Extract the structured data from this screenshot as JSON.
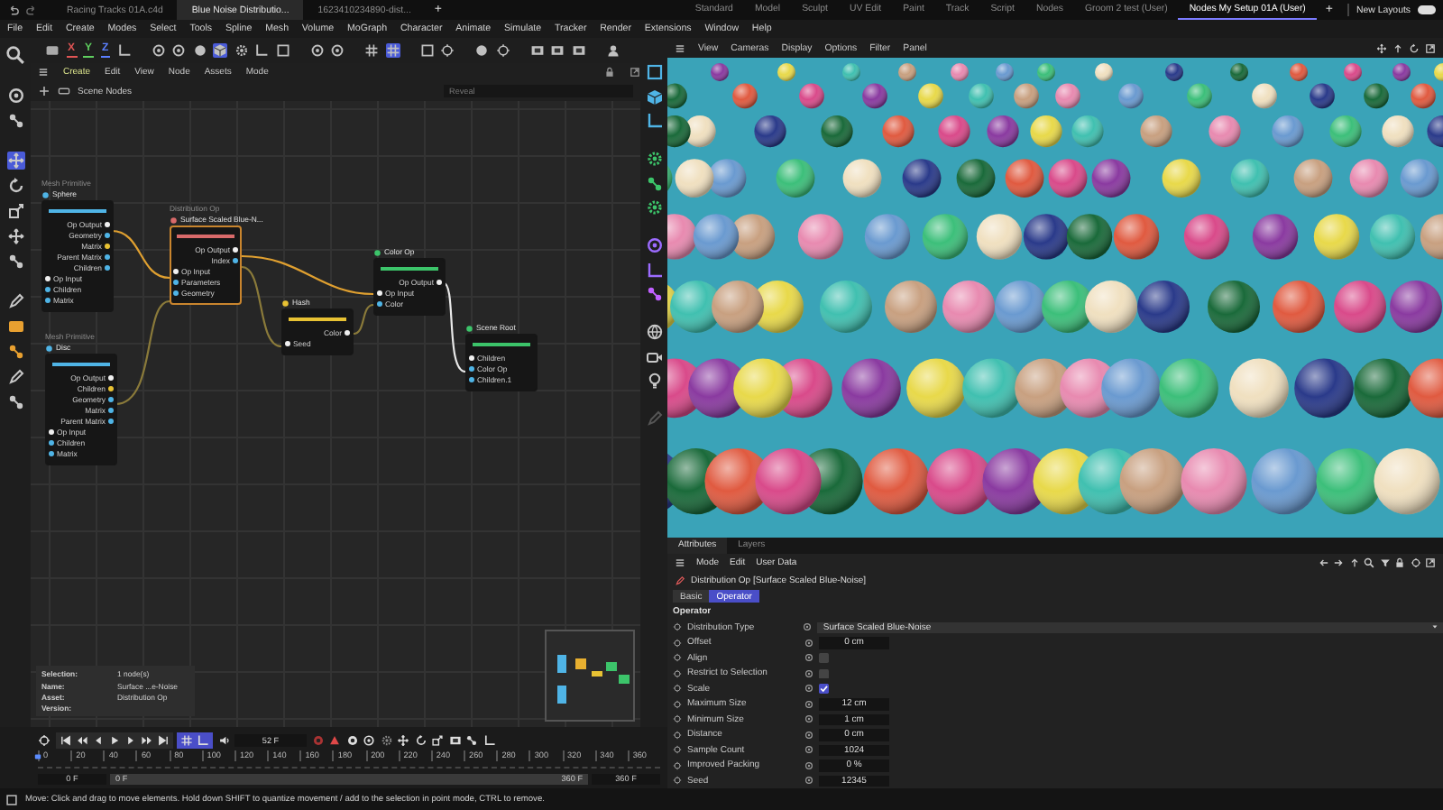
{
  "document_tabs": [
    {
      "label": "Racing Tracks 01A.c4d",
      "selected": false
    },
    {
      "label": "Blue Noise Distributio...",
      "selected": true
    },
    {
      "label": "1623410234890-dist...",
      "selected": false
    }
  ],
  "new_tab_button": "+",
  "layouts": [
    {
      "label": "Standard",
      "selected": false
    },
    {
      "label": "Model",
      "selected": false
    },
    {
      "label": "Sculpt",
      "selected": false
    },
    {
      "label": "UV Edit",
      "selected": false
    },
    {
      "label": "Paint",
      "selected": false
    },
    {
      "label": "Track",
      "selected": false
    },
    {
      "label": "Script",
      "selected": false
    },
    {
      "label": "Nodes",
      "selected": false
    },
    {
      "label": "Groom 2 test (User)",
      "selected": false
    },
    {
      "label": "Nodes My Setup 01A (User)",
      "selected": true
    }
  ],
  "add_layout_button": "+",
  "new_layouts": {
    "label": "New Layouts",
    "on": true
  },
  "menu": [
    "File",
    "Edit",
    "Create",
    "Modes",
    "Select",
    "Tools",
    "Spline",
    "Mesh",
    "Volume",
    "MoGraph",
    "Character",
    "Animate",
    "Simulate",
    "Tracker",
    "Render",
    "Extensions",
    "Window",
    "Help"
  ],
  "toolbar": {
    "axis_buttons": [
      {
        "label": "X",
        "color": "#e05555"
      },
      {
        "label": "Y",
        "color": "#5fcf5f"
      },
      {
        "label": "Z",
        "color": "#5b7fff"
      }
    ]
  },
  "node_editor": {
    "menu": [
      "Create",
      "Edit",
      "View",
      "Node",
      "Assets",
      "Mode"
    ],
    "path": "Scene Nodes",
    "search": {
      "placeholder": "Reveal"
    },
    "nodes": [
      {
        "caption": "Mesh Primitive",
        "title": "Sphere",
        "color": "#4fb4e6",
        "selected": false,
        "outputs": [
          "Op Output",
          "Geometry",
          "Matrix",
          "Parent Matrix",
          "Children"
        ],
        "inputs": [
          "Op Input",
          "Children",
          "Matrix"
        ]
      },
      {
        "caption": "Mesh Primitive",
        "title": "Disc",
        "color": "#4fb4e6",
        "selected": false,
        "outputs": [
          "Op Output",
          "Children",
          "Geometry",
          "Matrix",
          "Parent Matrix"
        ],
        "inputs": [
          "Op Input",
          "Children",
          "Matrix"
        ]
      },
      {
        "caption": "Distribution Op",
        "title": "Surface Scaled Blue-N...",
        "color": "#d96a6a",
        "selected": true,
        "outputs": [
          "Op Output",
          "Index"
        ],
        "inputs": [
          "Op Input",
          "Parameters",
          "Geometry"
        ]
      },
      {
        "title": "Hash",
        "color": "#e8c233",
        "selected": false,
        "outputs": [
          "Color"
        ],
        "inputs": [
          "Seed"
        ]
      },
      {
        "title": "Color Op",
        "color": "#3cc46a",
        "selected": false,
        "outputs": [
          "Op Output"
        ],
        "inputs": [
          "Op Input",
          "Color"
        ]
      },
      {
        "title": "Scene Root",
        "color": "#3cc46a",
        "selected": false,
        "inputs": [
          "Children",
          "Color Op",
          "Children.1"
        ]
      }
    ],
    "info": [
      {
        "key": "Selection:",
        "value": "1 node(s)"
      },
      {
        "key": "Name:",
        "value": "Surface ...e-Noise"
      },
      {
        "key": "Asset:",
        "value": "Distribution Op"
      },
      {
        "key": "Version:"
      }
    ]
  },
  "viewport": {
    "menu": [
      "View",
      "Cameras",
      "Display",
      "Options",
      "Filter",
      "Panel"
    ]
  },
  "attributes": {
    "tabs": [
      {
        "label": "Attributes",
        "selected": true
      },
      {
        "label": "Layers",
        "selected": false
      }
    ],
    "menu": [
      "Mode",
      "Edit",
      "User Data"
    ],
    "title": "Distribution Op [Surface Scaled Blue-Noise]",
    "subtabs": [
      {
        "label": "Basic",
        "selected": false
      },
      {
        "label": "Operator",
        "selected": true
      }
    ],
    "section": "Operator",
    "params": [
      {
        "label": "Distribution Type",
        "kind": "dropdown",
        "value": "Surface Scaled Blue-Noise"
      },
      {
        "label": "Offset",
        "kind": "number",
        "value": "0 cm"
      },
      {
        "label": "Align",
        "kind": "checkbox",
        "checked": false
      },
      {
        "label": "Restrict to Selection",
        "kind": "checkbox",
        "checked": false
      },
      {
        "label": "Scale",
        "kind": "checkbox",
        "checked": true
      },
      {
        "label": "Maximum Size",
        "kind": "number",
        "value": "12 cm"
      },
      {
        "label": "Minimum Size",
        "kind": "number",
        "value": "1 cm"
      },
      {
        "label": "Distance",
        "kind": "number",
        "value": "0 cm"
      },
      {
        "label": "Sample Count",
        "kind": "number",
        "value": "1024"
      },
      {
        "label": "Improved Packing",
        "kind": "number",
        "value": "0 %"
      },
      {
        "label": "Seed",
        "kind": "number",
        "value": "12345"
      }
    ]
  },
  "timeline": {
    "frame": "52 F",
    "ticks": [
      "0",
      "20",
      "40",
      "60",
      "80",
      "100",
      "120",
      "140",
      "160",
      "180",
      "200",
      "220",
      "240",
      "260",
      "280",
      "300",
      "320",
      "340",
      "360"
    ],
    "start": "0 F",
    "range": {
      "level": 1
    },
    "range_start": "0 F",
    "range_end": "360 F",
    "end": "360 F"
  },
  "status_bar": "Move: Click and drag to move elements. Hold down SHIFT to quantize movement / add to the selection in point mode, CTRL to remove."
}
